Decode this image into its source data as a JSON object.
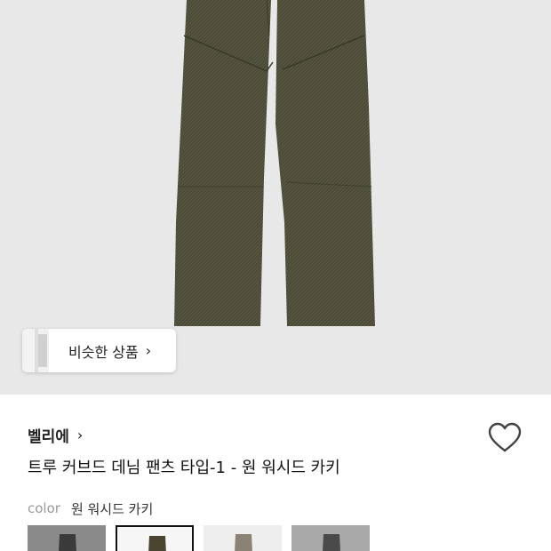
{
  "similar_products": {
    "label": "비슷한 상품",
    "chevron": "›"
  },
  "product": {
    "brand": "벨리에",
    "brand_chevron": "›",
    "title": "트루 커브드 데님 팬츠 타입-1 - 원 워시드 카키",
    "option_label": "color",
    "option_value": "원 워시드 카키"
  },
  "icons": {
    "wishlist": "heart-outline-icon",
    "brand_link": "chevron-right-icon"
  },
  "colors": {
    "hero_bg": "#e8e8e8",
    "pants": "#4b4b38",
    "swatches": [
      "#3a3a3a",
      "#4a4530",
      "#8a8275",
      "#4a4a4a"
    ]
  }
}
